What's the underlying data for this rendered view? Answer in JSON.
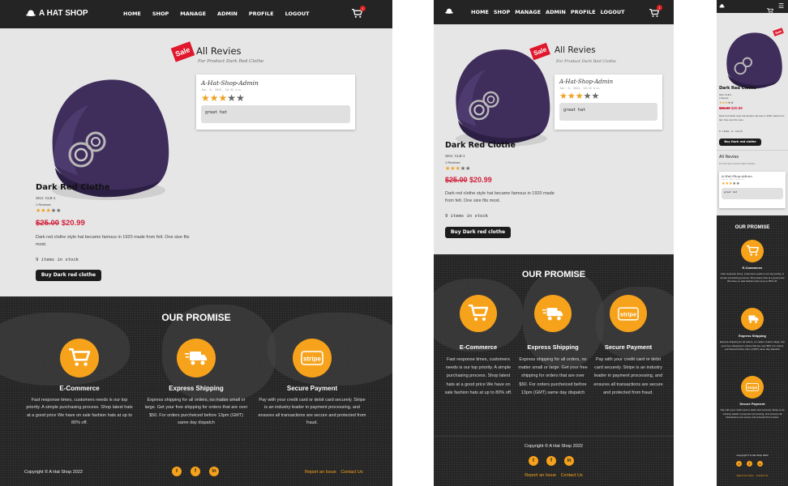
{
  "nav": {
    "brand": "A HAT SHOP",
    "links": [
      "HOME",
      "SHOP",
      "MANAGE",
      "ADMIN",
      "PROFILE",
      "LOGOUT"
    ],
    "cart_count": "1"
  },
  "product": {
    "sale_tag": "Sale",
    "name": "Dark Red Clothe",
    "sku": "SKU: CLB-1",
    "review_count": "1 Reviews",
    "rating": 3,
    "old_price": "$25.00",
    "new_price": "$20.99",
    "description": "Dark red clothe style hat became famous in 1920 made from felt. One size fits most.",
    "stock": "9 items in stock",
    "buy_label": "Buy Dark red clothe"
  },
  "reviews": {
    "title": "All Revies",
    "subtitle": "For Product Dark Red Clothe",
    "items": [
      {
        "author": "A-Hat-Shop-Admin",
        "date": "Jan. 6, 2022, 10:32 a.m.",
        "rating": 3,
        "text": "great hat"
      }
    ]
  },
  "promise": {
    "title": "OUR PROMISE",
    "features": [
      {
        "icon": "cart-icon",
        "title": "E-Commerce",
        "text": "Fast response times, customers needs is our top priority. A simple purchasing process. Shop latest hats at a good price We have on sale fashion hats at up to 80% off."
      },
      {
        "icon": "truck-icon",
        "title": "Express Shipping",
        "text": "Express shipping for all orders, no matter small or large. Get your free shipping for orders that are over $50. For orders purcheiced before 13pm (GMT) same day dispatch"
      },
      {
        "icon": "stripe-icon",
        "title": "Secure Payment",
        "text": "Pay with your credit card or debit card securely. Stripe is an industry leader in payment processing, and ensures all transactions are secure and protected from fraud."
      }
    ]
  },
  "footer": {
    "copyright": "Copyright © A Hat Shop 2022",
    "report": "Report an Issue",
    "contact": "Contact Us",
    "socials": [
      "twitter-icon",
      "facebook-icon",
      "linkedin-icon"
    ]
  },
  "colors": {
    "accent": "#f7a21b",
    "sale": "#e0182d",
    "dark": "#242424",
    "hat": "#3f2d5c"
  }
}
